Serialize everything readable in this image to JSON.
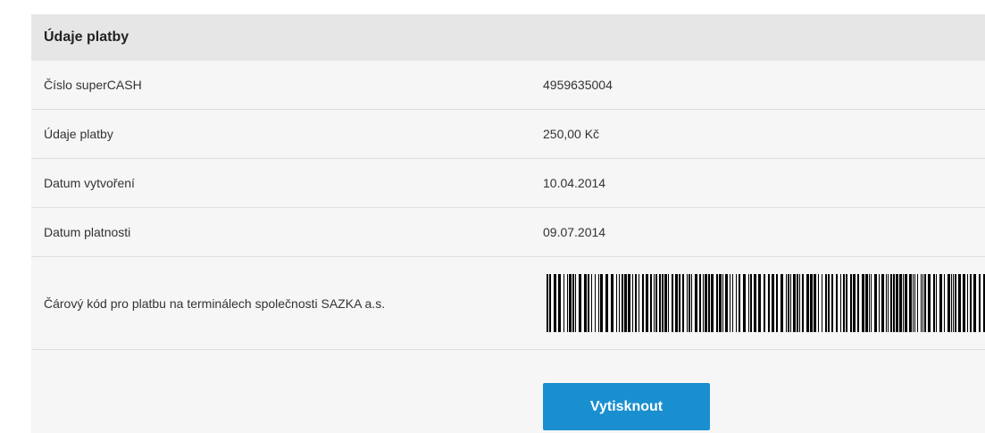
{
  "panel": {
    "title": "Údaje platby",
    "rows": [
      {
        "label": "Číslo superCASH",
        "value": "4959635004"
      },
      {
        "label": "Údaje platby",
        "value": "250,00 Kč"
      },
      {
        "label": "Datum vytvoření",
        "value": "10.04.2014"
      },
      {
        "label": "Datum platnosti",
        "value": "09.07.2014"
      }
    ],
    "barcode_label": "Čárový kód pro platbu na terminálech společnosti SAZKA a.s.",
    "print_button": "Vytisknout"
  },
  "colors": {
    "header_bg": "#e6e6e6",
    "panel_bg": "#f6f6f6",
    "button_bg": "#1a8fd0"
  }
}
